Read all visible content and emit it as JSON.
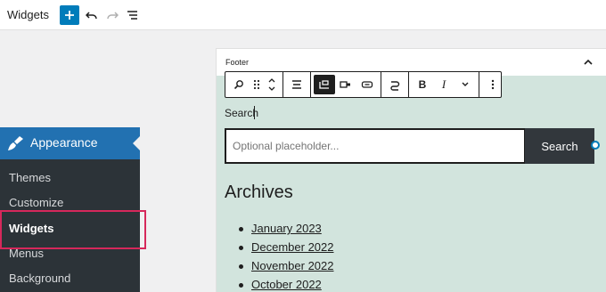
{
  "header": {
    "title": "Widgets",
    "add_icon": "plus-icon",
    "undo_icon": "undo-icon",
    "redo_icon": "redo-icon",
    "list_view_icon": "list-view-icon"
  },
  "sidebar": {
    "active_menu": "Appearance",
    "items": [
      {
        "label": "Themes"
      },
      {
        "label": "Customize"
      },
      {
        "label": "Widgets"
      },
      {
        "label": "Menus"
      },
      {
        "label": "Background"
      }
    ],
    "colors": {
      "menu_bg": "#1d2327",
      "active_bg": "#2271b1",
      "highlight_border": "#d6285b"
    }
  },
  "editor": {
    "area_label": "Footer",
    "search_label": "Search",
    "search_placeholder": "Optional placeholder...",
    "search_button": "Search",
    "archives_title": "Archives",
    "archives": [
      {
        "label": "January 2023"
      },
      {
        "label": "December 2022"
      },
      {
        "label": "November 2022"
      },
      {
        "label": "October 2022"
      }
    ],
    "toolbar_icons": [
      "search-block-icon",
      "drag-handle-icon",
      "move-up-down-icon",
      "align-icon",
      "button-outside-icon",
      "button-inside-icon",
      "button-only-icon",
      "link-icon",
      "bold-icon",
      "italic-icon",
      "more-formats-icon",
      "options-icon"
    ],
    "colors": {
      "widget_bg": "#d2e4dd",
      "button_bg": "#32373c",
      "accent": "#007cba"
    }
  }
}
